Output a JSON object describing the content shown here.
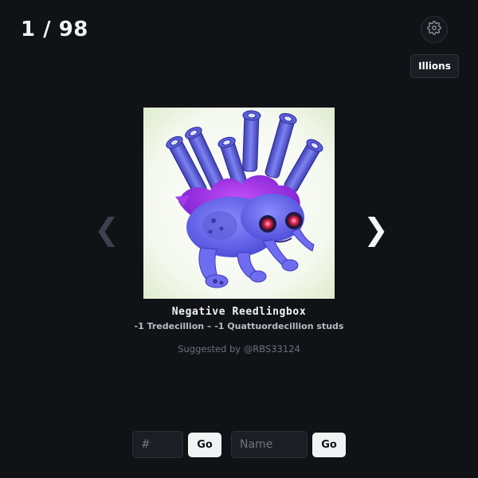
{
  "header": {
    "counter_current": "1",
    "counter_total": "98",
    "counter_text": "1 / 98",
    "settings_icon": "gear-icon",
    "illions_label": "Illions"
  },
  "viewer": {
    "prev_glyph": "❮",
    "next_glyph": "❯",
    "image_subject": "creature-image",
    "item_name": "Negative Reedlingbox",
    "item_value": "-1 Tredecillion – -1 Quattuordecillion studs",
    "suggested_by": "Suggested by @RBS33124"
  },
  "search": {
    "number_placeholder": "#",
    "number_go_label": "Go",
    "name_placeholder": "Name",
    "name_go_label": "Go"
  },
  "colors": {
    "background": "#111216",
    "prev_arrow_disabled": "#3c424d",
    "next_arrow": "#f4f5f7",
    "creature_body": "#6e6cf0",
    "creature_fur": "#9a2ee8"
  }
}
